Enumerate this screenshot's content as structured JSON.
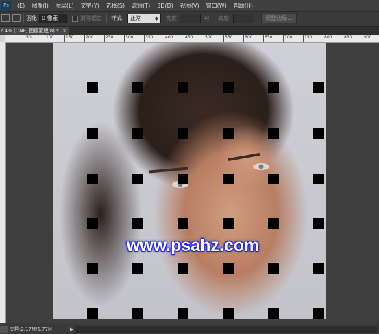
{
  "menu": {
    "logo": "Ps",
    "items": [
      "(E)",
      "图像(I)",
      "图层(L)",
      "文字(Y)",
      "选择(S)",
      "滤镜(T)",
      "3D(D)",
      "视图(V)",
      "窗口(W)",
      "帮助(H)"
    ]
  },
  "options": {
    "feather_label": "羽化:",
    "feather_value": "0 像素",
    "antialias_label": "消除锯齿",
    "style_label": "样式:",
    "style_value": "正常",
    "width_label": "宽度:",
    "height_label": "高度:",
    "swap_glyph": "⇄",
    "refine_edge": "调整边缘..."
  },
  "tab": {
    "label": "2.4% (ONE, 图层蒙版/8) *",
    "close": "×"
  },
  "ruler": {
    "labels": [
      "50",
      "100",
      "150",
      "200",
      "250",
      "300",
      "350",
      "400",
      "450",
      "500",
      "550",
      "600",
      "650",
      "700",
      "750",
      "800",
      "850",
      "900",
      "950"
    ]
  },
  "canvas": {
    "watermark": "www.psahz.com"
  },
  "status": {
    "doc": "文档:2.17M/5.77M",
    "arrow": "▶"
  }
}
